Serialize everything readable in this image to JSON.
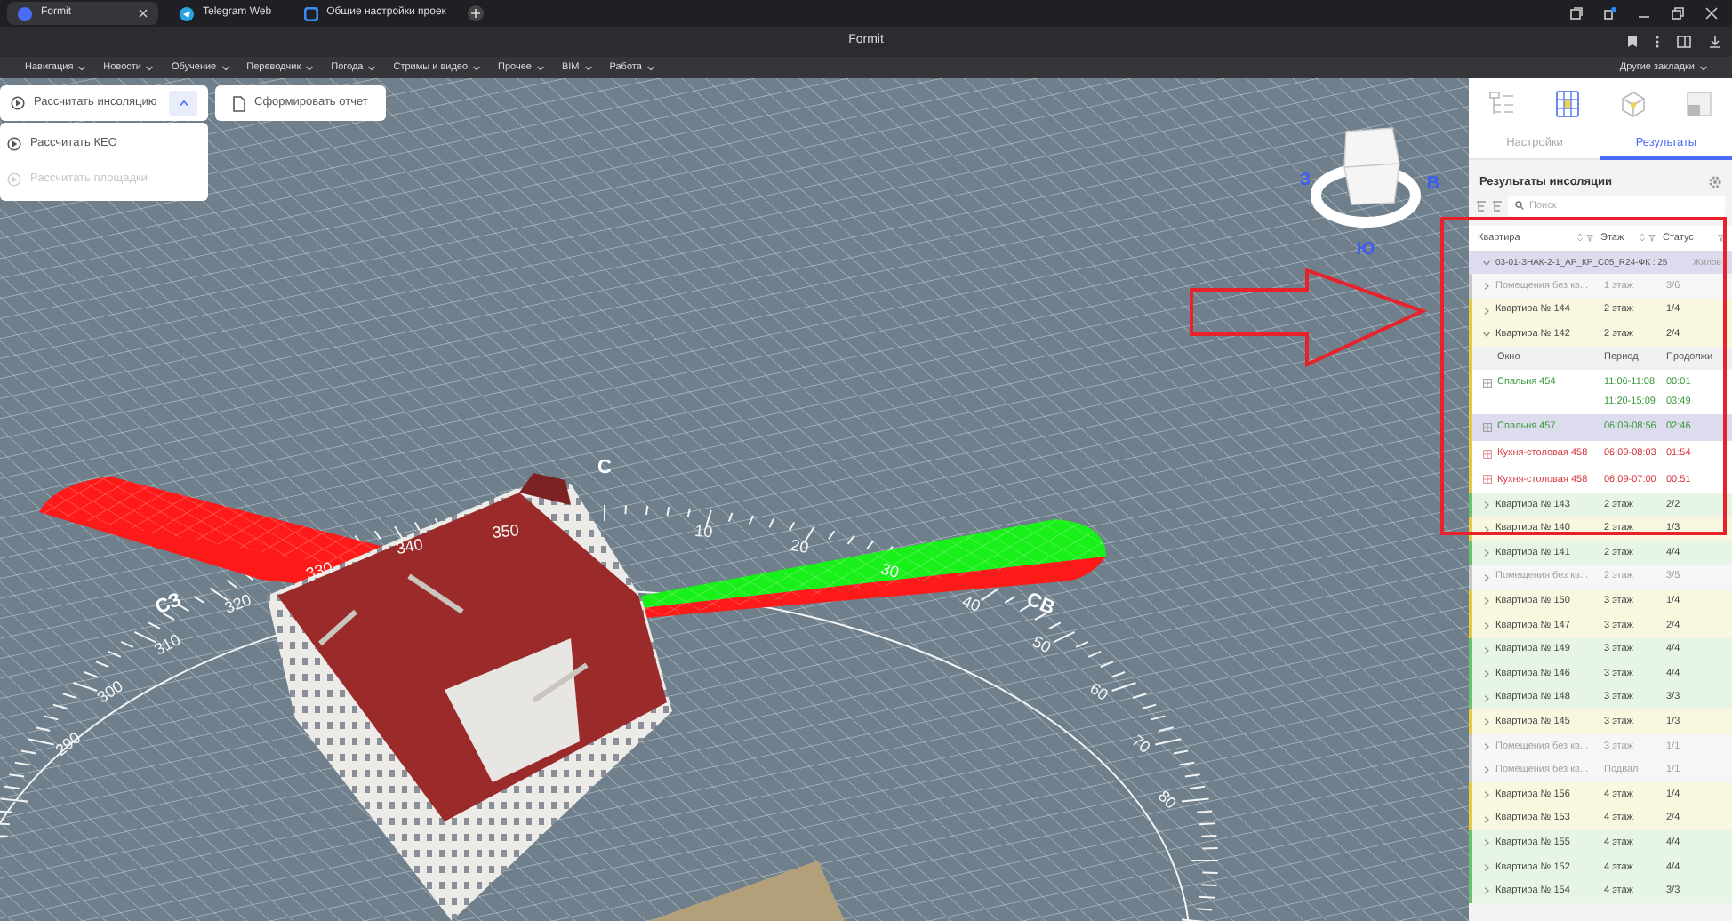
{
  "browser": {
    "tabs": [
      {
        "title": "Formit",
        "selected": true
      },
      {
        "title": "Telegram Web",
        "selected": false
      },
      {
        "title": "Общие настройки проек",
        "selected": false
      }
    ],
    "address": "Formit",
    "bookmarks": [
      "Навигация",
      "Новости",
      "Обучение",
      "Переводчик",
      "Погода",
      "Стримы и видео",
      "Прочее",
      "BIM",
      "Работа"
    ],
    "other_bookmarks": "Другие закладки"
  },
  "toolbar": {
    "calc_button": "Рассчитать инсоляцию",
    "menu_expanded": true,
    "report_button": "Сформировать отчет",
    "menu": [
      {
        "label": "Рассчитать КЕО",
        "disabled": false
      },
      {
        "label": "Рассчитать площадки",
        "disabled": true
      }
    ]
  },
  "viewport": {
    "compass_numbers": [
      "290",
      "300",
      "310",
      "320",
      "330",
      "340",
      "350",
      "10",
      "20",
      "30",
      "40",
      "50",
      "60",
      "70",
      "80"
    ],
    "direction_labels": [
      {
        "text": "С",
        "kind": "north"
      },
      {
        "text": "СЗ",
        "kind": "northwest"
      },
      {
        "text": "СВ",
        "kind": "northeast"
      }
    ],
    "view_cube_labels": [
      {
        "text": "З",
        "kind": "west"
      },
      {
        "text": "В",
        "kind": "east"
      },
      {
        "text": "Ю",
        "kind": "south"
      }
    ]
  },
  "panel": {
    "icon_tabs": [
      {
        "kind": "tree",
        "selected": false
      },
      {
        "kind": "grid",
        "selected": true
      },
      {
        "kind": "cube",
        "selected": false
      },
      {
        "kind": "layout",
        "selected": false
      }
    ],
    "tabs": [
      {
        "label": "Настройки",
        "selected": false
      },
      {
        "label": "Результаты",
        "selected": true
      }
    ],
    "title": "Результаты инсоляции",
    "search": {
      "placeholder": "Поиск"
    },
    "table": {
      "columns": [
        "Квартира",
        "Этаж",
        "Статус"
      ],
      "rows": [
        {
          "kind": "group",
          "name": "03-01-ЗНАК-2-1_АР_КР_С05_R24-ФК : 25",
          "status": "Жилое",
          "expanded": true
        },
        {
          "kind": "apartment",
          "name": "Помещения без кв...",
          "floor": "1 этаж",
          "status": "3/6",
          "color": "#c8c8c8",
          "dimmed": true,
          "expanded": false
        },
        {
          "kind": "apartment",
          "name": "Квартира № 144",
          "floor": "2 этаж",
          "status": "1/4",
          "color": "#e2ca45",
          "dimmed": false,
          "expanded": false
        },
        {
          "kind": "apartment",
          "name": "Квартира № 142",
          "floor": "2 этаж",
          "status": "2/4",
          "color": "#e2ca45",
          "dimmed": false,
          "expanded": true,
          "windows": {
            "columns": [
              "Окно",
              "Период",
              "Продолжи"
            ],
            "rows": [
              {
                "name": "Спальня 454",
                "periods": [
                  "11:06-11:08",
                  "11:20-15:09"
                ],
                "durations": [
                  "00:01",
                  "03:49"
                ],
                "passed": true,
                "selected": false
              },
              {
                "name": "Спальня 457",
                "periods": [
                  "06:09-08:56"
                ],
                "durations": [
                  "02:46"
                ],
                "passed": true,
                "selected": true
              },
              {
                "name": "Кухня-столовая 458",
                "periods": [
                  "06:09-08:03"
                ],
                "durations": [
                  "01:54"
                ],
                "passed": false,
                "selected": false
              },
              {
                "name": "Кухня-столовая 458",
                "periods": [
                  "06:09-07:00"
                ],
                "durations": [
                  "00:51"
                ],
                "passed": false,
                "selected": false
              }
            ]
          }
        },
        {
          "kind": "apartment",
          "name": "Квартира № 143",
          "floor": "2 этаж",
          "status": "2/2",
          "color": "#6cbf6c",
          "dimmed": false,
          "expanded": false
        },
        {
          "kind": "apartment",
          "name": "Квартира № 140",
          "floor": "2 этаж",
          "status": "1/3",
          "color": "#e2ca45",
          "dimmed": false,
          "expanded": false
        },
        {
          "kind": "apartment",
          "name": "Квартира № 141",
          "floor": "2 этаж",
          "status": "4/4",
          "color": "#6cbf6c",
          "dimmed": false,
          "expanded": false
        },
        {
          "kind": "apartment",
          "name": "Помещения без кв...",
          "floor": "2 этаж",
          "status": "3/5",
          "color": "#c8c8c8",
          "dimmed": true,
          "expanded": false
        },
        {
          "kind": "apartment",
          "name": "Квартира № 150",
          "floor": "3 этаж",
          "status": "1/4",
          "color": "#e2ca45",
          "dimmed": false,
          "expanded": false
        },
        {
          "kind": "apartment",
          "name": "Квартира № 147",
          "floor": "3 этаж",
          "status": "2/4",
          "color": "#e2ca45",
          "dimmed": false,
          "expanded": false
        },
        {
          "kind": "apartment",
          "name": "Квартира № 149",
          "floor": "3 этаж",
          "status": "4/4",
          "color": "#6cbf6c",
          "dimmed": false,
          "expanded": false
        },
        {
          "kind": "apartment",
          "name": "Квартира № 146",
          "floor": "3 этаж",
          "status": "4/4",
          "color": "#6cbf6c",
          "dimmed": false,
          "expanded": false
        },
        {
          "kind": "apartment",
          "name": "Квартира № 148",
          "floor": "3 этаж",
          "status": "3/3",
          "color": "#6cbf6c",
          "dimmed": false,
          "expanded": false
        },
        {
          "kind": "apartment",
          "name": "Квартира № 145",
          "floor": "3 этаж",
          "status": "1/3",
          "color": "#e2ca45",
          "dimmed": false,
          "expanded": false
        },
        {
          "kind": "apartment",
          "name": "Помещения без кв...",
          "floor": "3 этаж",
          "status": "1/1",
          "color": "#c8c8c8",
          "dimmed": true,
          "expanded": false
        },
        {
          "kind": "apartment",
          "name": "Помещения без кв...",
          "floor": "Подвал",
          "status": "1/1",
          "color": "#c8c8c8",
          "dimmed": true,
          "expanded": false
        },
        {
          "kind": "apartment",
          "name": "Квартира № 156",
          "floor": "4 этаж",
          "status": "1/4",
          "color": "#e2ca45",
          "dimmed": false,
          "expanded": false
        },
        {
          "kind": "apartment",
          "name": "Квартира № 153",
          "floor": "4 этаж",
          "status": "2/4",
          "color": "#e2ca45",
          "dimmed": false,
          "expanded": false
        },
        {
          "kind": "apartment",
          "name": "Квартира № 155",
          "floor": "4 этаж",
          "status": "4/4",
          "color": "#6cbf6c",
          "dimmed": false,
          "expanded": false
        },
        {
          "kind": "apartment",
          "name": "Квартира № 152",
          "floor": "4 этаж",
          "status": "4/4",
          "color": "#6cbf6c",
          "dimmed": false,
          "expanded": false
        },
        {
          "kind": "apartment",
          "name": "Квартира № 154",
          "floor": "4 этаж",
          "status": "3/3",
          "color": "#6cbf6c",
          "dimmed": false,
          "expanded": false
        }
      ]
    }
  }
}
